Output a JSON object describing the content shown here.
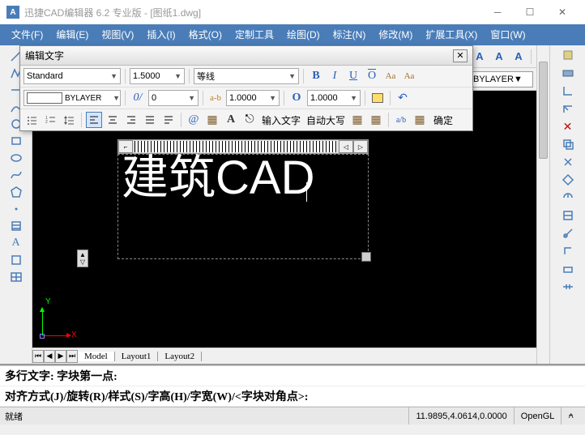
{
  "titlebar": {
    "app_icon": "A",
    "title": "迅捷CAD编辑器 6.2 专业版  - [图纸1.dwg]"
  },
  "menubar": {
    "items": [
      {
        "label": "文件(F)"
      },
      {
        "label": "编辑(E)"
      },
      {
        "label": "视图(V)"
      },
      {
        "label": "插入(I)"
      },
      {
        "label": "格式(O)"
      },
      {
        "label": "定制工具"
      },
      {
        "label": "绘图(D)"
      },
      {
        "label": "标注(N)"
      },
      {
        "label": "修改(M)"
      },
      {
        "label": "扩展工具(X)"
      },
      {
        "label": "窗口(W)"
      }
    ]
  },
  "top_tools": {
    "layer_value": "BYLAYER"
  },
  "dialog": {
    "title": "编辑文字",
    "font": "Standard",
    "size": "1.5000",
    "font2": "等线",
    "bold": "B",
    "italic": "I",
    "underline": "U",
    "overline": "O",
    "aa_up": "Aa",
    "aa_dn": "Aa",
    "bylayer": "BYLAYER",
    "slant": "0",
    "oval": "0",
    "ab": "a-b",
    "ab_val": "1.0000",
    "obig": "O",
    "obig_val": "1.0000",
    "at": "@",
    "book": "▦",
    "Abtn": "A",
    "lock": "⎋",
    "input_text": "输入文字",
    "auto_caps": "自动大写",
    "ruler": "▦",
    "check": "▦",
    "ab_frac": "a/b",
    "calc": "▦",
    "ok": "确定",
    "oslash": "0/"
  },
  "canvas": {
    "text": "建筑CAD",
    "ylabel": "Y",
    "xlabel": "X",
    "L": "⌐",
    "left_tri": "◁",
    "right_tri": "▷",
    "vA": "▲",
    "vV": "▽"
  },
  "tabs": {
    "model": "Model",
    "l1": "Layout1",
    "l2": "Layout2"
  },
  "command": {
    "line1": "多行文字: 字块第一点:",
    "line2": "对齐方式(J)/旋转(R)/样式(S)/字高(H)/字宽(W)/<字块对角点>:"
  },
  "status": {
    "ready": "就绪",
    "coords": "11.9895,4.0614,0.0000",
    "opengl": "OpenGL"
  }
}
